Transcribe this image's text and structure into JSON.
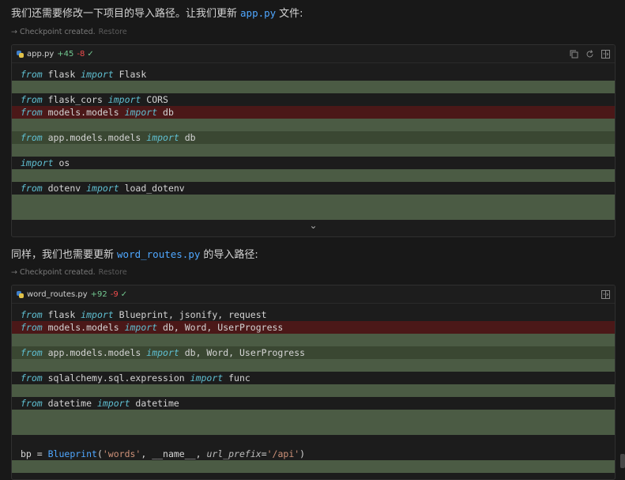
{
  "messages": [
    {
      "prefix": "我们还需要修改一下项目的导入路径。让我们更新",
      "code": "app.py",
      "suffix": "文件:"
    },
    {
      "prefix": "同样，我们也需要更新",
      "code": "word_routes.py",
      "suffix": "的导入路径:"
    }
  ],
  "checkpoint": {
    "text": "Checkpoint created.",
    "restore": "Restore",
    "arrow": "→"
  },
  "blocks": [
    {
      "filename": "app.py",
      "added": "+45",
      "removed": "-8",
      "check": "✓",
      "lines": [
        {
          "kind": "same",
          "tokens": [
            {
              "t": "kw",
              "v": "from"
            },
            {
              "t": "txt",
              "v": " flask "
            },
            {
              "t": "kw",
              "v": "import"
            },
            {
              "t": "txt",
              "v": " Flask"
            }
          ]
        },
        {
          "kind": "blank",
          "tokens": []
        },
        {
          "kind": "same",
          "tokens": [
            {
              "t": "kw",
              "v": "from"
            },
            {
              "t": "txt",
              "v": " flask_cors "
            },
            {
              "t": "kw",
              "v": "import"
            },
            {
              "t": "txt",
              "v": " CORS"
            }
          ]
        },
        {
          "kind": "del",
          "tokens": [
            {
              "t": "kw",
              "v": "from"
            },
            {
              "t": "txt",
              "v": " models.models "
            },
            {
              "t": "kw",
              "v": "import"
            },
            {
              "t": "txt",
              "v": " db"
            }
          ]
        },
        {
          "kind": "blank",
          "tokens": []
        },
        {
          "kind": "add",
          "tokens": [
            {
              "t": "kw",
              "v": "from"
            },
            {
              "t": "txt",
              "v": " app.models.models "
            },
            {
              "t": "kw",
              "v": "import"
            },
            {
              "t": "txt",
              "v": " db"
            }
          ]
        },
        {
          "kind": "blank",
          "tokens": []
        },
        {
          "kind": "same",
          "tokens": [
            {
              "t": "kw",
              "v": "import"
            },
            {
              "t": "txt",
              "v": " os"
            }
          ]
        },
        {
          "kind": "blank",
          "tokens": []
        },
        {
          "kind": "same",
          "tokens": [
            {
              "t": "kw",
              "v": "from"
            },
            {
              "t": "txt",
              "v": " dotenv "
            },
            {
              "t": "kw",
              "v": "import"
            },
            {
              "t": "txt",
              "v": " load_dotenv"
            }
          ]
        },
        {
          "kind": "blank",
          "tokens": []
        },
        {
          "kind": "blank",
          "tokens": []
        }
      ]
    },
    {
      "filename": "word_routes.py",
      "added": "+92",
      "removed": "-9",
      "check": "✓",
      "lines": [
        {
          "kind": "same",
          "tokens": [
            {
              "t": "kw",
              "v": "from"
            },
            {
              "t": "txt",
              "v": " flask "
            },
            {
              "t": "kw",
              "v": "import"
            },
            {
              "t": "txt",
              "v": " Blueprint, jsonify, request"
            }
          ]
        },
        {
          "kind": "del",
          "tokens": [
            {
              "t": "kw",
              "v": "from"
            },
            {
              "t": "txt",
              "v": " models.models "
            },
            {
              "t": "kw",
              "v": "import"
            },
            {
              "t": "txt",
              "v": " db, Word, UserProgress"
            }
          ]
        },
        {
          "kind": "blank",
          "tokens": []
        },
        {
          "kind": "add",
          "tokens": [
            {
              "t": "kw",
              "v": "from"
            },
            {
              "t": "txt",
              "v": " app.models.models "
            },
            {
              "t": "kw",
              "v": "import"
            },
            {
              "t": "txt",
              "v": " db, Word, UserProgress"
            }
          ]
        },
        {
          "kind": "blank",
          "tokens": []
        },
        {
          "kind": "same",
          "tokens": [
            {
              "t": "kw",
              "v": "from"
            },
            {
              "t": "txt",
              "v": " sqlalchemy.sql.expression "
            },
            {
              "t": "kw",
              "v": "import"
            },
            {
              "t": "txt",
              "v": " func"
            }
          ]
        },
        {
          "kind": "blank",
          "tokens": []
        },
        {
          "kind": "same",
          "tokens": [
            {
              "t": "kw",
              "v": "from"
            },
            {
              "t": "txt",
              "v": " datetime "
            },
            {
              "t": "kw",
              "v": "import"
            },
            {
              "t": "txt",
              "v": " datetime"
            }
          ]
        },
        {
          "kind": "blank",
          "tokens": []
        },
        {
          "kind": "blank",
          "tokens": []
        },
        {
          "kind": "same",
          "tokens": []
        },
        {
          "kind": "same",
          "tokens": [
            {
              "t": "txt",
              "v": "bp = "
            },
            {
              "t": "fn",
              "v": "Blueprint"
            },
            {
              "t": "txt",
              "v": "("
            },
            {
              "t": "str",
              "v": "'words'"
            },
            {
              "t": "txt",
              "v": ", __name__, "
            },
            {
              "t": "it",
              "v": "url_prefix"
            },
            {
              "t": "txt",
              "v": "="
            },
            {
              "t": "str",
              "v": "'/api'"
            },
            {
              "t": "txt",
              "v": ")"
            }
          ]
        },
        {
          "kind": "blank",
          "tokens": []
        }
      ]
    }
  ]
}
